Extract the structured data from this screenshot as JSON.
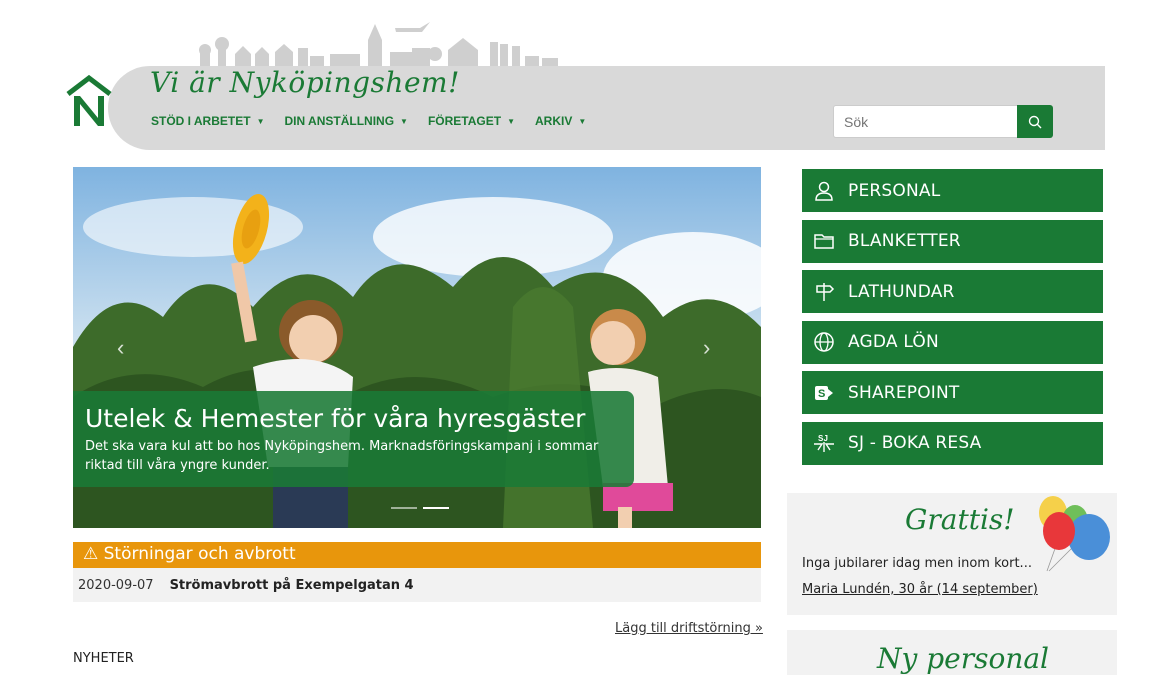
{
  "header": {
    "tagline": "Vi är Nyköpingshem!",
    "nav": [
      {
        "label": "STÖD I ARBETET"
      },
      {
        "label": "DIN ANSTÄLLNING"
      },
      {
        "label": "FÖRETAGET"
      },
      {
        "label": "ARKIV"
      }
    ],
    "search": {
      "placeholder": "Sök"
    }
  },
  "carousel": {
    "title": "Utelek & Hemester för våra hyresgäster",
    "text": "Det ska vara kul att bo hos Nyköpingshem. Marknadsföringskampanj i sommar riktad till våra yngre kunder.",
    "prev": "‹",
    "next": "›",
    "active_slide": 2,
    "slide_count": 2
  },
  "disturbances": {
    "heading": "⚠ Störningar och avbrott",
    "items": [
      {
        "date": "2020-09-07",
        "title": "Strömavbrott på Exempelgatan 4"
      }
    ],
    "add_link": "Lägg till driftstörning »"
  },
  "news": {
    "heading": "NYHETER"
  },
  "quicklinks": [
    {
      "label": "PERSONAL",
      "icon": "person-icon"
    },
    {
      "label": "BLANKETTER",
      "icon": "folder-icon"
    },
    {
      "label": "LATHUNDAR",
      "icon": "signpost-icon"
    },
    {
      "label": "AGDA LÖN",
      "icon": "globe-icon"
    },
    {
      "label": "SHAREPOINT",
      "icon": "sharepoint-icon"
    },
    {
      "label": "SJ - BOKA RESA",
      "icon": "sj-icon"
    }
  ],
  "birthday": {
    "title": "Grattis!",
    "text": "Inga jubilarer idag men inom kort...",
    "link": "Maria Lundén, 30 år (14 september)"
  },
  "new_staff": {
    "title": "Ny personal"
  },
  "colors": {
    "brand_green": "#1a7a35",
    "warning_orange": "#e8960c",
    "banner_gray": "#d9d9d9"
  }
}
